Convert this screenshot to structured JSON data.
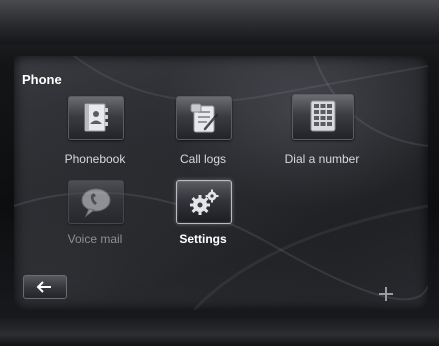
{
  "screen": {
    "title": "Phone"
  },
  "menu": {
    "items": [
      {
        "label": "Phonebook",
        "icon": "phonebook-icon",
        "state": "normal"
      },
      {
        "label": "Call logs",
        "icon": "call-logs-icon",
        "state": "normal"
      },
      {
        "label": "Dial a number",
        "icon": "keypad-icon",
        "state": "normal"
      },
      {
        "label": "Voice mail",
        "icon": "voicemail-icon",
        "state": "disabled"
      },
      {
        "label": "Settings",
        "icon": "settings-gears-icon",
        "state": "selected"
      }
    ]
  },
  "footer": {
    "back_icon": "back-arrow-icon",
    "add_icon": "plus-icon"
  },
  "colors": {
    "text": "#ffffff",
    "tile_border_selected": "#b9bcc4",
    "screen_background": "#26272b"
  }
}
